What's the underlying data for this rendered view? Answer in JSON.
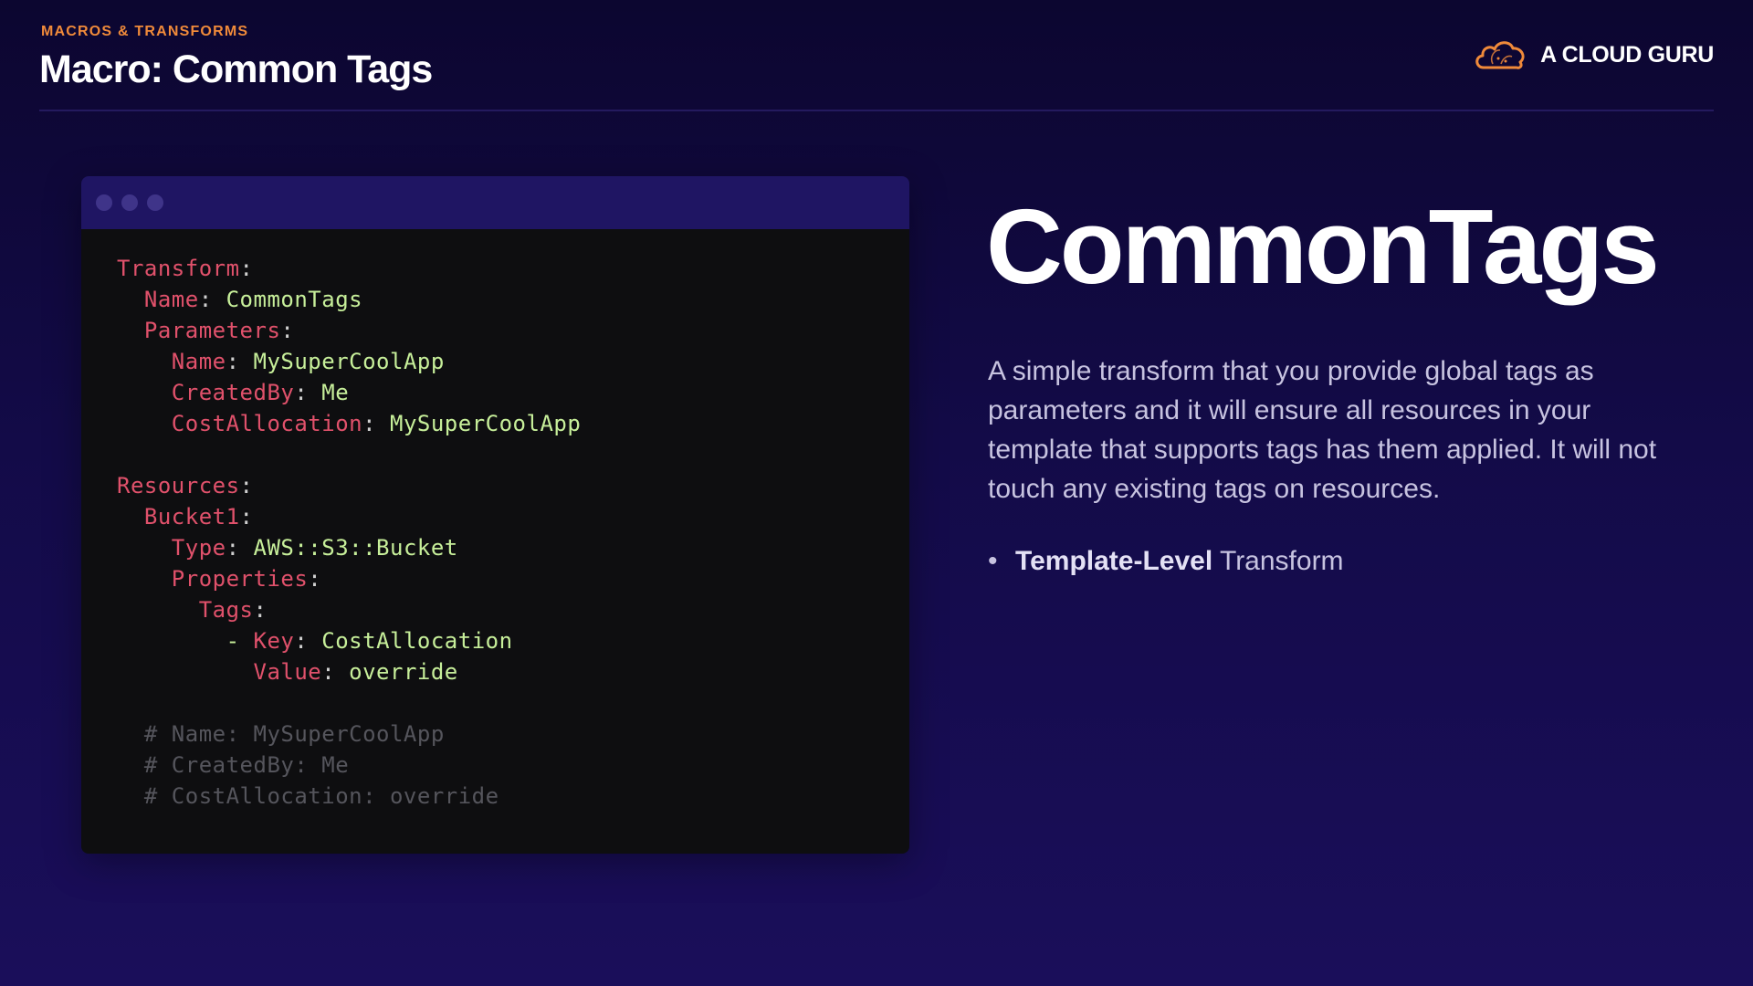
{
  "header": {
    "kicker": "MACROS & TRANSFORMS",
    "title": "Macro: Common Tags",
    "brand": "A CLOUD GURU"
  },
  "code_window": {
    "lines": [
      [
        {
          "t": "Transform",
          "c": "k"
        },
        {
          "t": ":",
          "c": "p"
        }
      ],
      [
        {
          "t": "  Name",
          "c": "k"
        },
        {
          "t": ": ",
          "c": "p"
        },
        {
          "t": "CommonTags",
          "c": "v"
        }
      ],
      [
        {
          "t": "  Parameters",
          "c": "k"
        },
        {
          "t": ":",
          "c": "p"
        }
      ],
      [
        {
          "t": "    Name",
          "c": "k"
        },
        {
          "t": ": ",
          "c": "p"
        },
        {
          "t": "MySuperCoolApp",
          "c": "v"
        }
      ],
      [
        {
          "t": "    CreatedBy",
          "c": "k"
        },
        {
          "t": ": ",
          "c": "p"
        },
        {
          "t": "Me",
          "c": "v"
        }
      ],
      [
        {
          "t": "    CostAllocation",
          "c": "k"
        },
        {
          "t": ": ",
          "c": "p"
        },
        {
          "t": "MySuperCoolApp",
          "c": "v"
        }
      ],
      [],
      [
        {
          "t": "Resources",
          "c": "k"
        },
        {
          "t": ":",
          "c": "p"
        }
      ],
      [
        {
          "t": "  Bucket1",
          "c": "k"
        },
        {
          "t": ":",
          "c": "p"
        }
      ],
      [
        {
          "t": "    Type",
          "c": "k"
        },
        {
          "t": ": ",
          "c": "p"
        },
        {
          "t": "AWS::S3::Bucket",
          "c": "v"
        }
      ],
      [
        {
          "t": "    Properties",
          "c": "k"
        },
        {
          "t": ":",
          "c": "p"
        }
      ],
      [
        {
          "t": "      Tags",
          "c": "k"
        },
        {
          "t": ":",
          "c": "p"
        }
      ],
      [
        {
          "t": "        - ",
          "c": "v"
        },
        {
          "t": "Key",
          "c": "k"
        },
        {
          "t": ": ",
          "c": "p"
        },
        {
          "t": "CostAllocation",
          "c": "v"
        }
      ],
      [
        {
          "t": "          Value",
          "c": "k"
        },
        {
          "t": ": ",
          "c": "p"
        },
        {
          "t": "override",
          "c": "v"
        }
      ],
      [],
      [
        {
          "t": "  # Name: MySuperCoolApp",
          "c": "c"
        }
      ],
      [
        {
          "t": "  # CreatedBy: Me",
          "c": "c"
        }
      ],
      [
        {
          "t": "  # CostAllocation: override",
          "c": "c"
        }
      ]
    ]
  },
  "content": {
    "big_title": "CommonTags",
    "description": "A simple transform that you provide global tags as parameters and it will ensure all resources in your template that supports tags has them applied. It will not touch any existing tags on resources.",
    "bullets": [
      {
        "bold": "Template-Level",
        "rest": " Transform"
      }
    ]
  },
  "colors": {
    "accent": "#f08a3a",
    "key": "#e0516b",
    "value": "#c7ef9a",
    "comment": "#55555c"
  },
  "icons": {
    "brand": "cloud-logo-icon"
  }
}
